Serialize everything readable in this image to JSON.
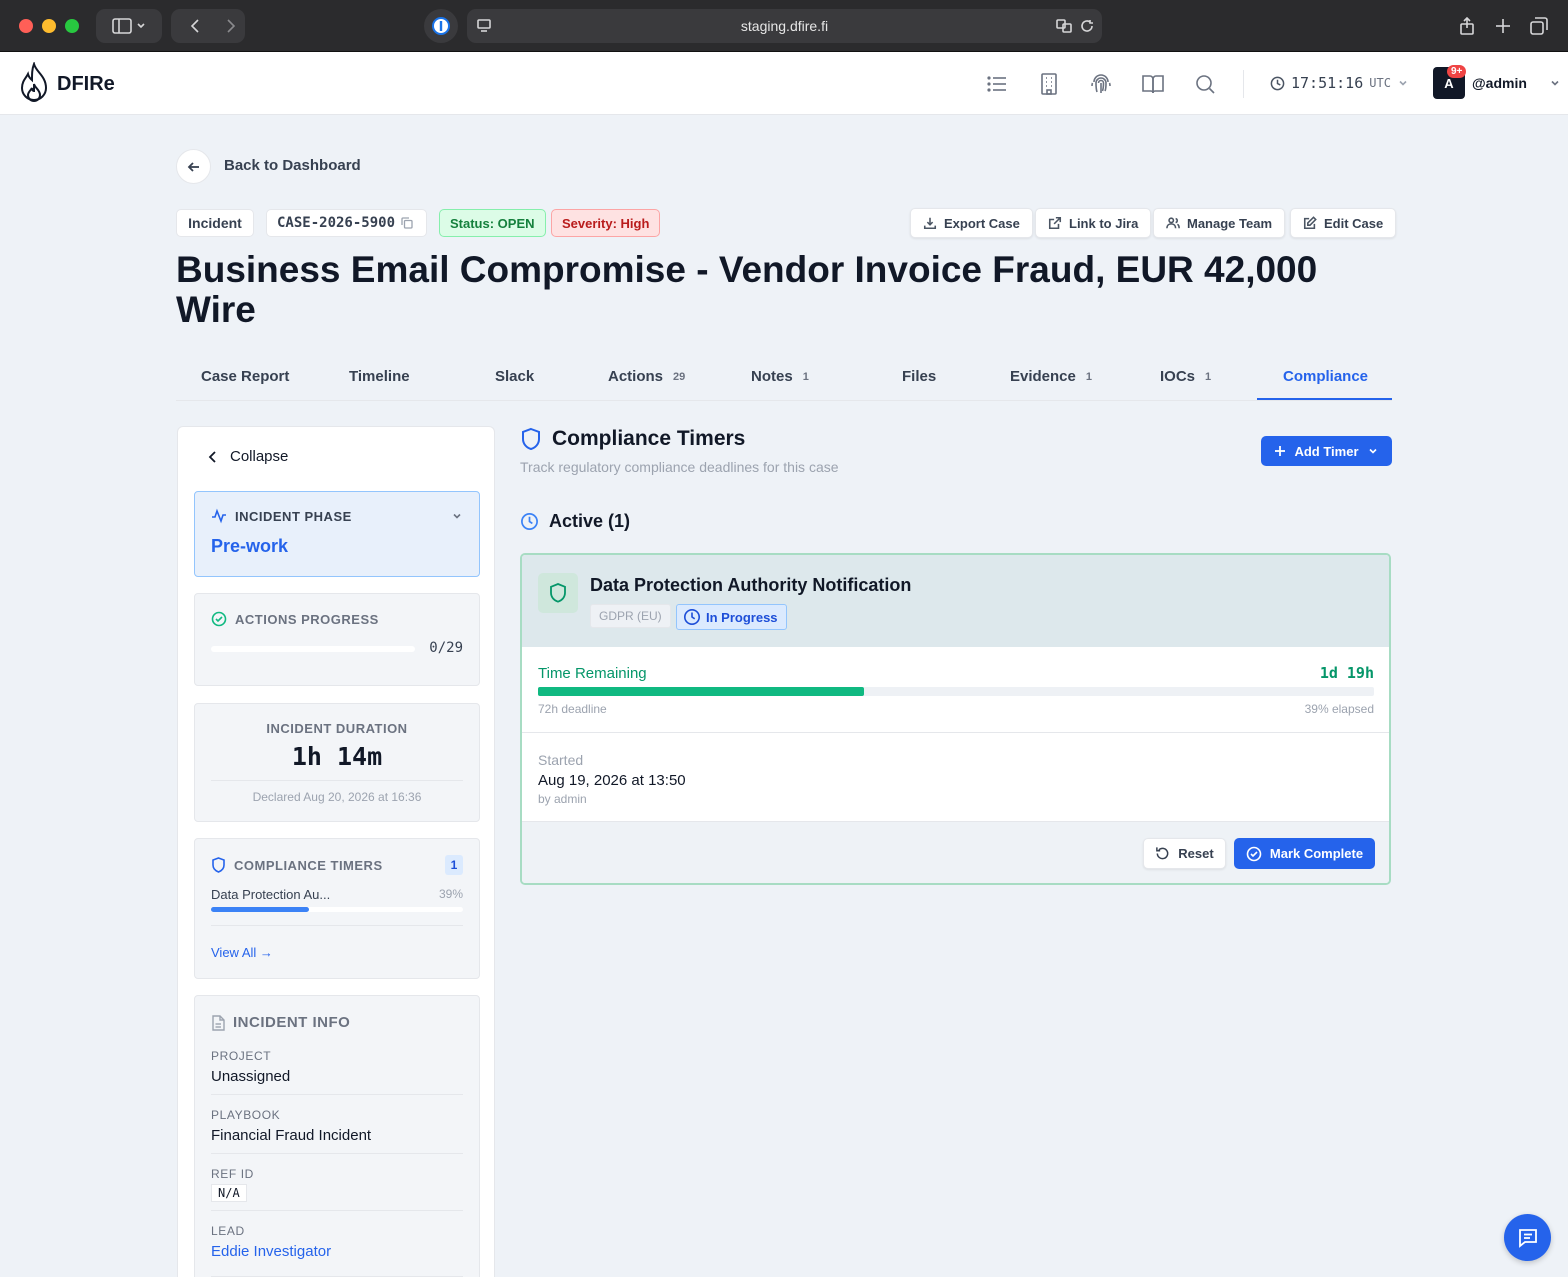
{
  "browser": {
    "url": "staging.dfire.fi"
  },
  "header": {
    "brand": "DFIRe",
    "time": "17:51:16",
    "timezone": "UTC",
    "user": "@admin",
    "avatar_letter": "A",
    "notification_badge": "9+",
    "icons": [
      "list-icon",
      "building-icon",
      "fingerprint-icon",
      "book-icon",
      "search-icon"
    ]
  },
  "page": {
    "back_label": "Back to Dashboard",
    "type_chip": "Incident",
    "case_id": "CASE-2026-5900",
    "status_chip": "Status: OPEN",
    "severity_chip": "Severity: High",
    "actions": {
      "export": "Export Case",
      "jira": "Link to Jira",
      "team": "Manage Team",
      "edit": "Edit Case"
    },
    "title": "Business Email Compromise - Vendor Invoice Fraud, EUR 42,000 Wire",
    "tabs": [
      {
        "label": "Case Report",
        "count": ""
      },
      {
        "label": "Timeline",
        "count": ""
      },
      {
        "label": "Slack",
        "count": ""
      },
      {
        "label": "Actions",
        "count": "29"
      },
      {
        "label": "Notes",
        "count": "1"
      },
      {
        "label": "Files",
        "count": ""
      },
      {
        "label": "Evidence",
        "count": "1"
      },
      {
        "label": "IOCs",
        "count": "1"
      },
      {
        "label": "Compliance",
        "count": ""
      }
    ],
    "active_tab": "Compliance"
  },
  "sidebar": {
    "collapse_label": "Collapse",
    "phase": {
      "heading": "INCIDENT PHASE",
      "value": "Pre-work"
    },
    "actions_progress": {
      "heading": "ACTIONS PROGRESS",
      "value": "0/29",
      "fraction": 0
    },
    "duration": {
      "heading": "INCIDENT DURATION",
      "value": "1h 14m",
      "declared": "Declared Aug 20, 2026 at 16:36"
    },
    "compliance": {
      "heading": "COMPLIANCE TIMERS",
      "count": "1",
      "item_label": "Data Protection Au...",
      "item_percent": "39%",
      "item_fraction": 0.39,
      "view_all": "View All →"
    },
    "info": {
      "heading": "INCIDENT INFO",
      "project_label": "PROJECT",
      "project_value": "Unassigned",
      "playbook_label": "PLAYBOOK",
      "playbook_value": "Financial Fraud Incident",
      "ref_label": "REF ID",
      "ref_value": "N/A",
      "lead_label": "LEAD",
      "lead_value": "Eddie Investigator"
    }
  },
  "compliance": {
    "title": "Compliance Timers",
    "subtitle": "Track regulatory compliance deadlines for this case",
    "add_button": "Add Timer",
    "active_heading": "Active (1)",
    "timer": {
      "name": "Data Protection Authority Notification",
      "regulation": "GDPR (EU)",
      "status": "In Progress",
      "remaining_label": "Time Remaining",
      "remaining_value": "1d 19h",
      "deadline": "72h deadline",
      "elapsed": "39% elapsed",
      "elapsed_fraction": 0.39,
      "started_label": "Started",
      "started_value": "Aug 19, 2026 at 13:50",
      "started_by": "by admin",
      "reset_label": "Reset",
      "complete_label": "Mark Complete"
    }
  },
  "colors": {
    "accent": "#2563eb",
    "success": "#10b981",
    "status_open_bg": "#dcfce7",
    "severity_high_bg": "#fee2e2"
  }
}
